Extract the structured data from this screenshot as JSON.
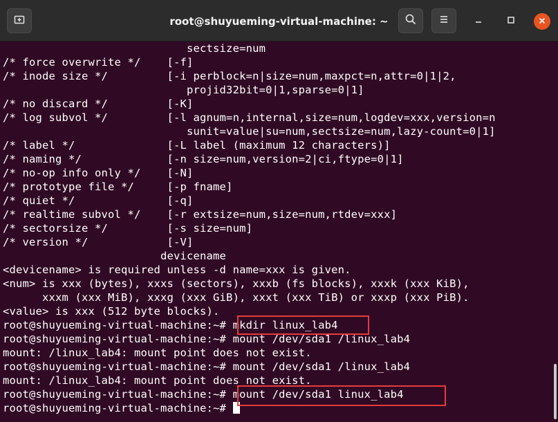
{
  "window": {
    "title": "root@shuyueming-virtual-machine: ~"
  },
  "toolbar": {
    "new_tab_icon": "new-tab-icon",
    "search_icon": "search-icon",
    "menu_icon": "hamburger-menu-icon",
    "minimize_icon": "minimize-icon",
    "maximize_icon": "maximize-icon",
    "close_icon": "close-icon"
  },
  "colors": {
    "terminal_bg": "#300a24",
    "titlebar_bg": "#2c2c2c",
    "text": "#ffffff",
    "close_button": "#e95420",
    "highlight_box": "#e83a3a"
  },
  "terminal": {
    "lines": [
      "                            sectsize=num",
      "/* force overwrite */    [-f]",
      "/* inode size */         [-i perblock=n|size=num,maxpct=n,attr=0|1|2,",
      "                            projid32bit=0|1,sparse=0|1]",
      "/* no discard */         [-K]",
      "/* log subvol */         [-l agnum=n,internal,size=num,logdev=xxx,version=n",
      "                            sunit=value|su=num,sectsize=num,lazy-count=0|1]",
      "/* label */              [-L label (maximum 12 characters)]",
      "/* naming */             [-n size=num,version=2|ci,ftype=0|1]",
      "/* no-op info only */    [-N]",
      "/* prototype file */     [-p fname]",
      "/* quiet */              [-q]",
      "/* realtime subvol */    [-r extsize=num,size=num,rtdev=xxx]",
      "/* sectorsize */         [-s size=num]",
      "/* version */            [-V]",
      "                        devicename",
      "<devicename> is required unless -d name=xxx is given.",
      "<num> is xxx (bytes), xxxs (sectors), xxxb (fs blocks), xxxk (xxx KiB),",
      "      xxxm (xxx MiB), xxxg (xxx GiB), xxxt (xxx TiB) or xxxp (xxx PiB).",
      "<value> is xxx (512 byte blocks).",
      "root@shuyueming-virtual-machine:~# mkdir linux_lab4",
      "root@shuyueming-virtual-machine:~# mount /dev/sda1 /linux_lab4",
      "mount: /linux_lab4: mount point does not exist.",
      "root@shuyueming-virtual-machine:~# mount /dev/sda1 /linux_lab4",
      "mount: /linux_lab4: mount point does not exist.",
      "root@shuyueming-virtual-machine:~# mount /dev/sda1 linux_lab4"
    ],
    "prompt": "root@shuyueming-virtual-machine:~# "
  }
}
